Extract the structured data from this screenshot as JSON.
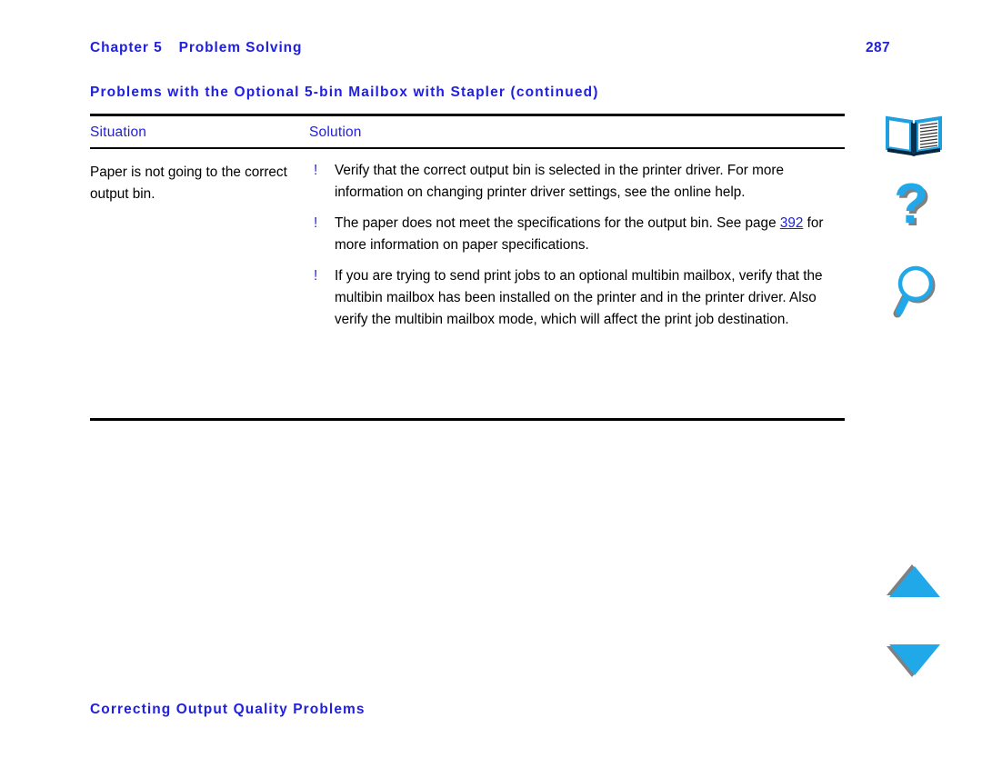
{
  "header": {
    "chapter_label": "Chapter 5",
    "chapter_title": "Problem Solving",
    "page_number": "287"
  },
  "section": {
    "title": "Problems with the Optional 5-bin Mailbox with Stapler (continued)"
  },
  "table": {
    "columns": [
      "Situation",
      "Solution"
    ],
    "rows": [
      {
        "situation": "Paper is not going to the correct output bin.",
        "bullet_marker": "!",
        "solutions": [
          {
            "text_before": "Verify that the correct output bin is selected in the printer driver. For more information on changing printer driver settings, see the online help.",
            "link": "",
            "text_after": ""
          },
          {
            "text_before": "The paper does not meet the specifications for the output bin. See page ",
            "link": "392",
            "text_after": " for more information on paper specifications."
          },
          {
            "text_before": "If you are trying to send print jobs to an optional multibin mailbox, verify that the multibin mailbox has been installed on the printer and in the printer driver. Also verify the multibin mailbox mode, which will affect the print job destination.",
            "link": "",
            "text_after": ""
          }
        ]
      }
    ]
  },
  "footer": {
    "title": "Correcting Output Quality Problems"
  },
  "nav": {
    "book_label": "Table of contents",
    "help_label": "Help",
    "search_label": "Search",
    "previous_label": "Previous page",
    "next_label": "Next page"
  },
  "colors": {
    "link_blue": "#2020e0",
    "icon_cyan": "#20a8e8",
    "icon_shadow": "#808080",
    "rule_black": "#000000"
  }
}
